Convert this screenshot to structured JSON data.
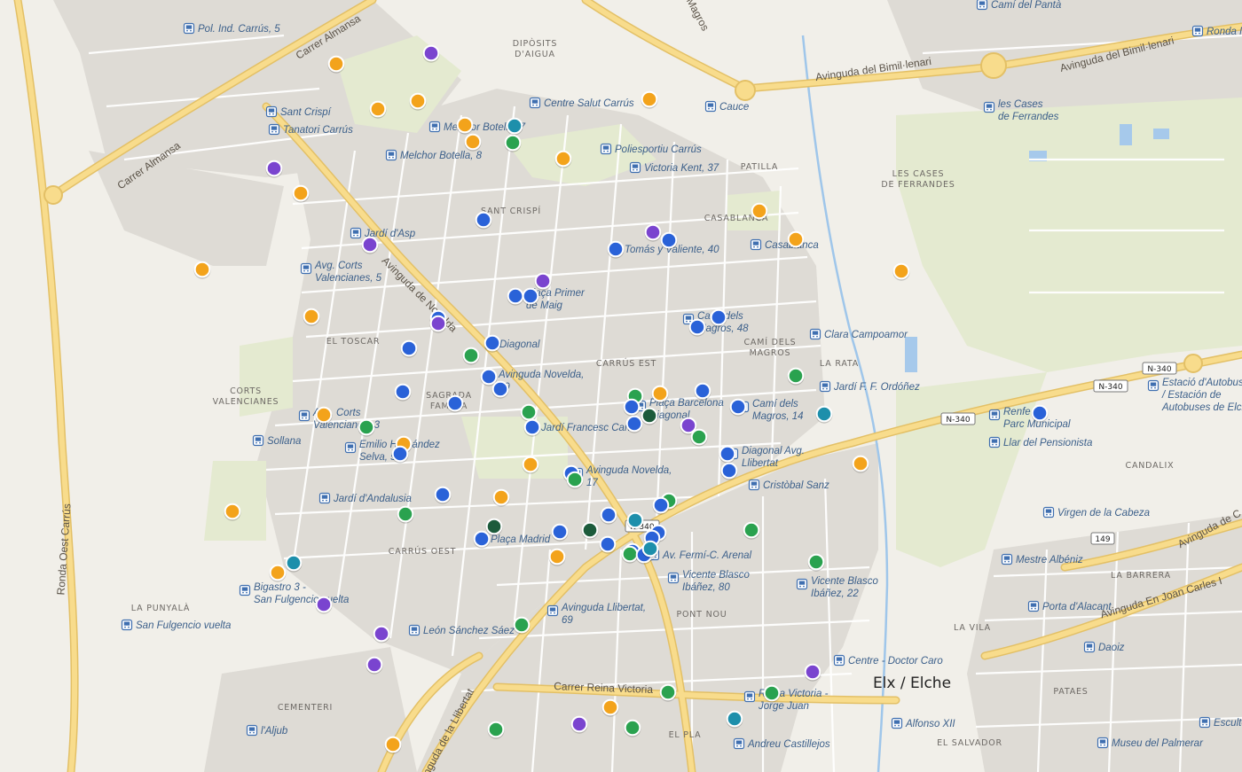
{
  "colors": {
    "orange": "#f3a31b",
    "purple": "#7a44cf",
    "blue": "#2a62d8",
    "green": "#2aa24f",
    "darkgreen": "#1c5b3b",
    "teal": "#1d8fab",
    "background": "#f1efe9",
    "building": "#dddad4",
    "park": "#e6ecd2",
    "major_road": "#f6d982",
    "water": "#9fc6ea"
  },
  "map": {
    "city_label": "Elx / Elche",
    "district_labels": [
      "DIPÒSITS D'AIGUA",
      "PATILLA",
      "SANT CRISPÍ",
      "CASABLANCA",
      "LES CASES DE FERRANDES",
      "EL TOSCAR",
      "CAMÍ DELS MAGROS",
      "LA RATA",
      "CARRÚS EST",
      "CORTS VALENCIANES",
      "SAGRADA FAMÍLIA",
      "CANDALIX",
      "CARRÚS OEST",
      "LA BARRERA",
      "LA PUNYALÀ",
      "PONT NOU",
      "LA VILA",
      "CEMENTERI",
      "PATAES",
      "EL PLA",
      "EL SALVADOR"
    ],
    "road_labels": [
      "Carrer Almansa",
      "Carrer Almansa",
      "Avinguda del Bimil·lenari",
      "Avinguda del Bimil·lenari",
      "Avinguda de Novelda",
      "Ronda Oest Carrús",
      "Avinguda de la Llibertat",
      "Carrer Reina Victoria",
      "Avinguda En Joan Carles I",
      "Avinguda de C",
      "Magros"
    ],
    "road_shields": [
      "N-340",
      "N-340",
      "N-340",
      "N-340",
      "149"
    ],
    "stops": [
      "Pol. Ind. Carrús, 5",
      "Camí del Pantà",
      "Ronda N",
      "Sant Crispí",
      "Tanatori Carrús",
      "Melchor Botella, 7",
      "Centre Salut Carrús",
      "Cauce",
      "les Cases de Ferrandes",
      "Melchor Botella, 8",
      "Poliesportiu Carrús",
      "Victoria Kent, 37",
      "Jardí d'Asp",
      "Tomás y Valiente, 40",
      "Casablanca",
      "Avg. Corts Valencianes, 5",
      "Plaça Primer de Maig",
      "Camí dels Magros, 48",
      "Clara Campoamor",
      "Diagonal",
      "Jardí F. F. Ordóñez",
      "Avinguda Novelda, 59",
      "Plaça Barcelona Diagonal",
      "Camí dels Magros, 14",
      "Estació d'Autobusos d'Elx / Estación de Autobuses de Elche",
      "Renfe - Parc Municipal",
      "Avg. Corts Valencianes, 3",
      "Jardí Francesc Cano",
      "Llar del Pensionista",
      "Sollana",
      "Emilio Hernández Selva, 54",
      "Diagonal Avg. Llibertat",
      "Avinguda Novelda, 17",
      "Cristòbal Sanz",
      "Jardí d'Andalusia",
      "Virgen de la Cabeza",
      "Plaça Madrid",
      "Mestre Albéniz",
      "Bigastro 3 - San Fulgencio vuelta",
      "Av. Fermí-C. Arenal",
      "Vicente Blasco Ibáñez, 80",
      "Vicente Blasco Ibáñez, 22",
      "Porta d'Alacant",
      "San Fulgencio vuelta",
      "Avinguda Llibertat, 69",
      "León Sánchez Sáez",
      "Daoiz",
      "Centre - Doctor Caro",
      "Reina Victoria - Jorge Juan",
      "Alfonso XII",
      "Escultor",
      "l'Aljub",
      "Andreu Castillejos",
      "Museu del Palmerar"
    ]
  }
}
